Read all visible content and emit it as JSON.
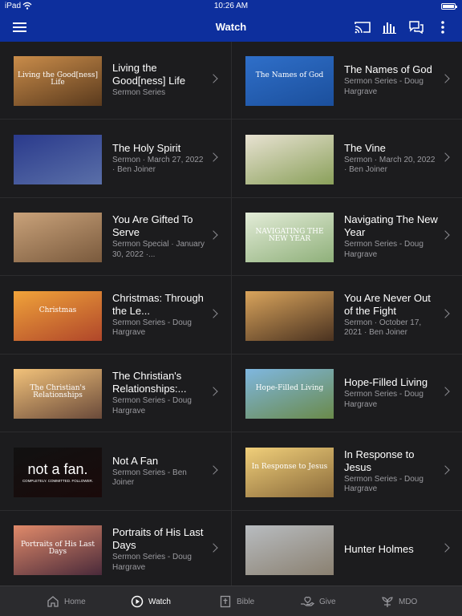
{
  "status": {
    "carrier": "iPad",
    "time": "10:26 AM"
  },
  "header": {
    "title": "Watch",
    "icons": [
      "menu-icon",
      "cast-icon",
      "audio-bars-icon",
      "chat-icon",
      "more-vertical-icon"
    ]
  },
  "items": [
    {
      "title": "Living the Good[ness] Life",
      "meta": "Sermon Series",
      "thumb_text": "Living the Good[ness] Life",
      "thumb_colors": [
        "#c98c4a",
        "#5a3a1d"
      ]
    },
    {
      "title": "The Names of God",
      "meta": "Sermon Series - Doug Hargrave",
      "thumb_text": "The Names of God",
      "thumb_colors": [
        "#2f6fc9",
        "#1b4f9c"
      ]
    },
    {
      "title": "The Holy Spirit",
      "meta": "Sermon · March 27, 2022 · Ben Joiner",
      "thumb_text": "",
      "thumb_colors": [
        "#2a3a8c",
        "#5a6fa8"
      ]
    },
    {
      "title": "The Vine",
      "meta": "Sermon · March 20, 2022 · Ben Joiner",
      "thumb_text": "",
      "thumb_colors": [
        "#e8e2d2",
        "#8aa05a"
      ]
    },
    {
      "title": "You Are Gifted To Serve",
      "meta": "Sermon Special · January 30, 2022 ·...",
      "thumb_text": "",
      "thumb_colors": [
        "#c9a27a",
        "#7a5a3d"
      ]
    },
    {
      "title": "Navigating The New Year",
      "meta": "Sermon Series - Doug Hargrave",
      "thumb_text": "NAVIGATING THE NEW YEAR",
      "thumb_colors": [
        "#e3ecd8",
        "#8fb07a"
      ]
    },
    {
      "title": "Christmas: Through the Le...",
      "meta": "Sermon Series - Doug Hargrave",
      "thumb_text": "Christmas",
      "thumb_colors": [
        "#f0a33a",
        "#b0462a"
      ]
    },
    {
      "title": "You Are Never Out of the Fight",
      "meta": "Sermon · October 17, 2021 · Ben Joiner",
      "thumb_text": "",
      "thumb_colors": [
        "#d9a45c",
        "#4a3220"
      ]
    },
    {
      "title": "The Christian's Relationships:...",
      "meta": "Sermon Series - Doug Hargrave",
      "thumb_text": "The Christian's Relationships",
      "thumb_colors": [
        "#f2c27a",
        "#6a4a3a"
      ]
    },
    {
      "title": "Hope-Filled Living",
      "meta": "Sermon Series - Doug Hargrave",
      "thumb_text": "Hope-Filled Living",
      "thumb_colors": [
        "#7fb7e0",
        "#6a8a4a"
      ]
    },
    {
      "title": "Not A Fan",
      "meta": "Sermon Series - Ben Joiner",
      "thumb_text": "not a fan.",
      "thumb_sub": "COMPLETELY. COMMITTED. FOLLOWER.",
      "thumb_colors": [
        "#111111",
        "#1a0a0a"
      ]
    },
    {
      "title": "In Response to Jesus",
      "meta": "Sermon Series - Doug Hargrave",
      "thumb_text": "In Response to Jesus",
      "thumb_colors": [
        "#f0cf7a",
        "#8a6a3a"
      ]
    },
    {
      "title": "Portraits of His Last Days",
      "meta": "Sermon Series - Doug Hargrave",
      "thumb_text": "Portraits of His Last Days",
      "thumb_colors": [
        "#e08a6a",
        "#4a2a3a"
      ]
    },
    {
      "title": "Hunter Holmes",
      "meta": "",
      "thumb_text": "",
      "thumb_colors": [
        "#b8bcc0",
        "#8a8070"
      ]
    }
  ],
  "tabs": [
    {
      "label": "Home",
      "icon": "home-icon",
      "active": false
    },
    {
      "label": "Watch",
      "icon": "play-circle-icon",
      "active": true
    },
    {
      "label": "Bible",
      "icon": "bible-icon",
      "active": false
    },
    {
      "label": "Give",
      "icon": "give-icon",
      "active": false
    },
    {
      "label": "MDO",
      "icon": "sprout-icon",
      "active": false
    }
  ]
}
